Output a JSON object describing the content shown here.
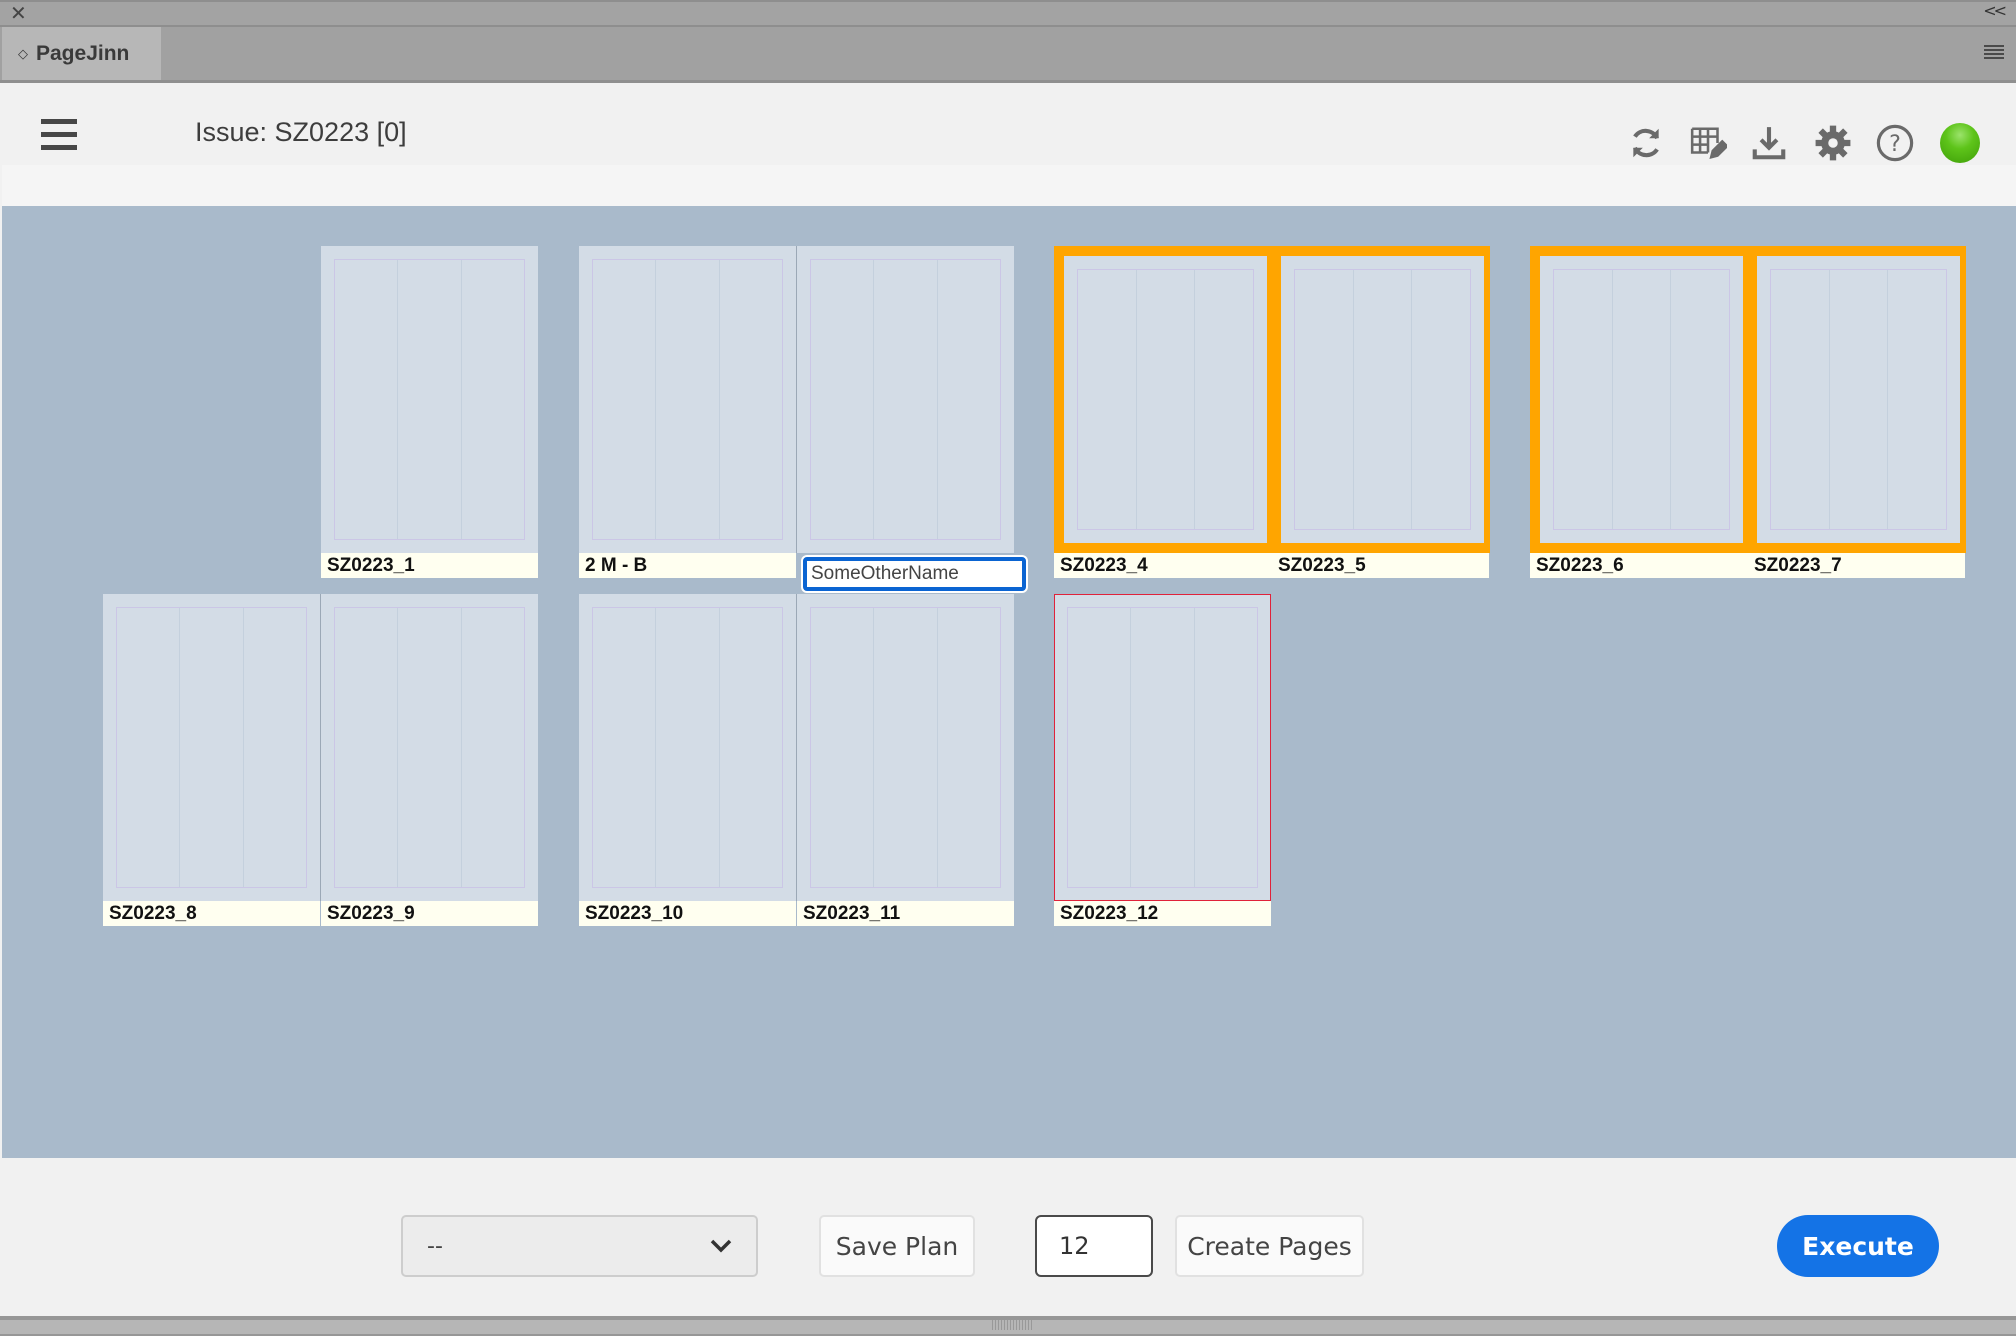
{
  "window": {
    "close_icon": "close-icon",
    "collapse_label": "<<"
  },
  "panel": {
    "tab_label": "PageJinn",
    "menu_icon": "panel-menu-icon"
  },
  "header": {
    "title": "Issue: SZ0223 [0]",
    "icons": [
      "refresh-icon",
      "grid-edit-icon",
      "download-icon",
      "gear-icon",
      "help-icon"
    ],
    "status_color": "#5ec41a"
  },
  "colors": {
    "selected": "#ffa500",
    "error": "#e0223a",
    "accent": "#1473e6",
    "canvas": "#a9bacb"
  },
  "plan": {
    "spreads": [
      {
        "row": 0,
        "col": 0,
        "selected": false,
        "pages": [
          null,
          {
            "name": "SZ0223_1"
          }
        ]
      },
      {
        "row": 0,
        "col": 1,
        "selected": false,
        "pages": [
          {
            "name": "2 M - B"
          },
          {
            "name": "SomeOtherName",
            "editing": true
          }
        ]
      },
      {
        "row": 0,
        "col": 2,
        "selected": true,
        "pages": [
          {
            "name": "SZ0223_4"
          },
          {
            "name": "SZ0223_5"
          }
        ]
      },
      {
        "row": 0,
        "col": 3,
        "selected": true,
        "pages": [
          {
            "name": "SZ0223_6"
          },
          {
            "name": "SZ0223_7"
          }
        ]
      },
      {
        "row": 1,
        "col": 0,
        "selected": false,
        "pages": [
          {
            "name": "SZ0223_8"
          },
          {
            "name": "SZ0223_9"
          }
        ]
      },
      {
        "row": 1,
        "col": 1,
        "selected": false,
        "pages": [
          {
            "name": "SZ0223_10"
          },
          {
            "name": "SZ0223_11"
          }
        ]
      },
      {
        "row": 1,
        "col": 2,
        "selected": false,
        "error": true,
        "pages": [
          {
            "name": "SZ0223_12"
          }
        ]
      }
    ]
  },
  "footer": {
    "plan_select_value": "--",
    "save_plan": "Save Plan",
    "page_count": "12",
    "create_pages": "Create Pages",
    "execute": "Execute"
  }
}
